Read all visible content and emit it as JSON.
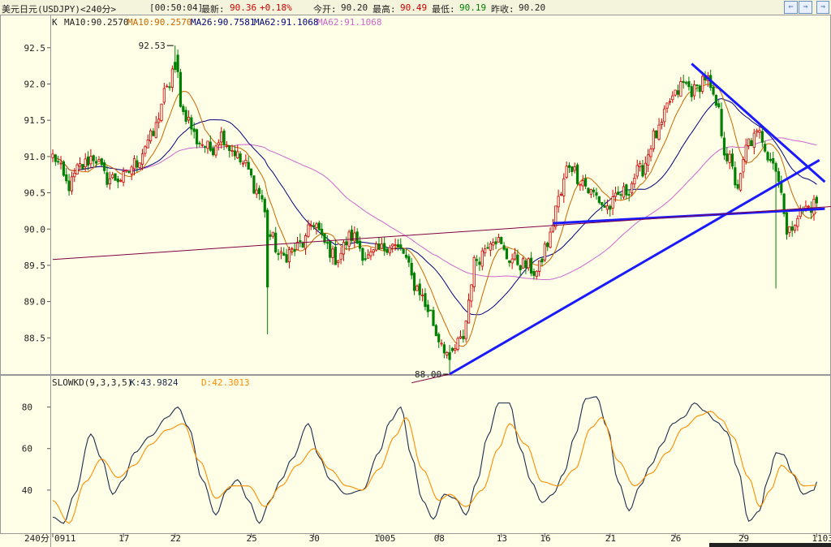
{
  "header": {
    "instrument": "美元日元(USDJPY)<240分>",
    "time": "[00:50:04]",
    "latest_label": "最新:",
    "latest_value": "90.36",
    "change": "+0.18%",
    "open_label": "今开:",
    "open_value": "90.20",
    "high_label": "最高:",
    "high_value": "90.49",
    "low_label": "最低:",
    "low_value": "90.19",
    "prev_label": "昨收:",
    "prev_value": "90.20",
    "buttons": [
      "⇐",
      "⇒",
      "⇐",
      "⇒"
    ]
  },
  "colors": {
    "background": "#ffffe8",
    "up": "#d00000",
    "down": "#008000",
    "ma10": "#cc6600",
    "ma26": "#000080",
    "ma62": "#cc66cc",
    "trendline": "#1a1aff",
    "horizontal": "#800040",
    "k_line": "#1c2c4c",
    "d_line": "#ff8c00"
  },
  "indicator_bar": {
    "k_label": "K",
    "ma10_a": "MA10:90.2570",
    "ma10_b": "MA10:90.2570",
    "ma26": "MA26:90.7581",
    "ma62_a": "MA62:91.1068",
    "ma62_b": "MA62:91.1068"
  },
  "kd_bar": {
    "name": "SLOWKD(9,3,3,5)",
    "k": "K:43.9824",
    "d": "D:42.3013"
  },
  "annotations": {
    "high_marker": "92.53",
    "low_marker": "88.00"
  },
  "bottom_axis": {
    "period": "240分",
    "labels": [
      "0911",
      "17",
      "22",
      "25",
      "30",
      "1005",
      "08",
      "13",
      "16",
      "21",
      "26",
      "29",
      "1103"
    ]
  },
  "chart_data": [
    {
      "type": "candlestick",
      "series_name": "USDJPY 240分",
      "ylim": [
        88.0,
        92.8
      ],
      "yticks": [
        "92.5",
        "92.0",
        "91.5",
        "91.0",
        "90.5",
        "90.0",
        "89.5",
        "89.0",
        "88.5"
      ],
      "ytick_values": [
        92.5,
        92.0,
        91.5,
        91.0,
        90.5,
        90.0,
        89.5,
        89.0,
        88.5
      ],
      "xtick_labels": [
        "0911",
        "17",
        "22",
        "25",
        "30",
        "1005",
        "08",
        "13",
        "16",
        "21",
        "26",
        "29",
        "1103"
      ],
      "xtick_bar_index": [
        0,
        26,
        45,
        73,
        96,
        120,
        142,
        165,
        181,
        205,
        229,
        254,
        281
      ],
      "bar_count": 282,
      "high": 92.53,
      "low": 88.0,
      "last_close": 90.36,
      "ma_latest": {
        "MA10": 90.257,
        "MA26": 90.7581,
        "MA62": 91.1068
      },
      "anchors": [
        [
          0,
          91.0
        ],
        [
          6,
          90.6
        ],
        [
          10,
          90.85
        ],
        [
          15,
          91.0
        ],
        [
          20,
          90.7
        ],
        [
          26,
          90.7
        ],
        [
          30,
          90.9
        ],
        [
          36,
          91.25
        ],
        [
          42,
          91.9
        ],
        [
          45,
          92.3
        ],
        [
          48,
          91.6
        ],
        [
          54,
          91.2
        ],
        [
          58,
          91.1
        ],
        [
          62,
          91.3
        ],
        [
          66,
          91.1
        ],
        [
          70,
          90.9
        ],
        [
          76,
          90.5
        ],
        [
          80,
          89.9
        ],
        [
          84,
          89.6
        ],
        [
          88,
          89.7
        ],
        [
          92,
          89.8
        ],
        [
          96,
          90.1
        ],
        [
          100,
          89.8
        ],
        [
          104,
          89.6
        ],
        [
          110,
          89.9
        ],
        [
          116,
          89.6
        ],
        [
          120,
          89.7
        ],
        [
          124,
          89.8
        ],
        [
          128,
          89.7
        ],
        [
          134,
          89.2
        ],
        [
          138,
          88.9
        ],
        [
          142,
          88.5
        ],
        [
          146,
          88.25
        ],
        [
          150,
          88.45
        ],
        [
          156,
          89.6
        ],
        [
          162,
          89.9
        ],
        [
          168,
          89.6
        ],
        [
          174,
          89.5
        ],
        [
          178,
          89.4
        ],
        [
          182,
          89.8
        ],
        [
          186,
          90.4
        ],
        [
          190,
          90.9
        ],
        [
          194,
          90.7
        ],
        [
          198,
          90.5
        ],
        [
          204,
          90.3
        ],
        [
          210,
          90.5
        ],
        [
          216,
          90.8
        ],
        [
          222,
          91.3
        ],
        [
          228,
          91.8
        ],
        [
          232,
          92.0
        ],
        [
          236,
          91.9
        ],
        [
          240,
          92.1
        ],
        [
          244,
          91.7
        ],
        [
          248,
          91.0
        ],
        [
          252,
          90.6
        ],
        [
          256,
          91.2
        ],
        [
          260,
          91.3
        ],
        [
          264,
          91.0
        ],
        [
          268,
          90.6
        ],
        [
          270,
          89.9
        ],
        [
          274,
          90.2
        ],
        [
          278,
          90.3
        ],
        [
          281,
          90.36
        ]
      ],
      "trendlines": [
        {
          "name": "rising-support",
          "from": [
            146,
            88.0
          ],
          "to": [
            282,
            90.95
          ]
        },
        {
          "name": "falling-resistance",
          "from": [
            235,
            92.28
          ],
          "to": [
            284,
            90.65
          ]
        },
        {
          "name": "flat-support",
          "from": [
            184,
            90.08
          ],
          "to": [
            284,
            90.28
          ]
        },
        {
          "name": "long-horizontal",
          "from": [
            0,
            89.58
          ],
          "to": [
            302,
            90.35
          ]
        },
        {
          "name": "extension",
          "from": [
            132,
            87.88
          ],
          "to": [
            146,
            88.0
          ]
        }
      ]
    },
    {
      "type": "line",
      "title": "SLOWKD(9,3,3,5)",
      "ylim": [
        20,
        90
      ],
      "yticks": [
        "80",
        "60",
        "40"
      ],
      "ytick_values": [
        80,
        60,
        40
      ],
      "series": [
        {
          "name": "K",
          "latest": 43.9824,
          "anchors": [
            [
              0,
              27
            ],
            [
              4,
              24
            ],
            [
              8,
              38
            ],
            [
              14,
              67
            ],
            [
              18,
              55
            ],
            [
              22,
              38
            ],
            [
              26,
              45
            ],
            [
              30,
              58
            ],
            [
              36,
              66
            ],
            [
              42,
              75
            ],
            [
              46,
              80
            ],
            [
              50,
              70
            ],
            [
              55,
              45
            ],
            [
              60,
              28
            ],
            [
              64,
              40
            ],
            [
              68,
              45
            ],
            [
              72,
              35
            ],
            [
              76,
              24
            ],
            [
              80,
              35
            ],
            [
              84,
              45
            ],
            [
              88,
              55
            ],
            [
              94,
              72
            ],
            [
              98,
              56
            ],
            [
              102,
              45
            ],
            [
              108,
              38
            ],
            [
              114,
              40
            ],
            [
              120,
              58
            ],
            [
              124,
              73
            ],
            [
              128,
              80
            ],
            [
              132,
              56
            ],
            [
              136,
              35
            ],
            [
              140,
              26
            ],
            [
              144,
              38
            ],
            [
              148,
              36
            ],
            [
              152,
              28
            ],
            [
              156,
              44
            ],
            [
              160,
              66
            ],
            [
              164,
              82
            ],
            [
              168,
              82
            ],
            [
              172,
              60
            ],
            [
              176,
              44
            ],
            [
              180,
              34
            ],
            [
              184,
              38
            ],
            [
              188,
              48
            ],
            [
              192,
              66
            ],
            [
              196,
              84
            ],
            [
              200,
              85
            ],
            [
              204,
              70
            ],
            [
              208,
              44
            ],
            [
              212,
              30
            ],
            [
              216,
              42
            ],
            [
              220,
              52
            ],
            [
              224,
              62
            ],
            [
              228,
              72
            ],
            [
              232,
              75
            ],
            [
              236,
              82
            ],
            [
              240,
              78
            ],
            [
              244,
              73
            ],
            [
              248,
              68
            ],
            [
              252,
              50
            ],
            [
              256,
              25
            ],
            [
              260,
              30
            ],
            [
              263,
              45
            ],
            [
              266,
              58
            ],
            [
              269,
              57
            ],
            [
              272,
              48
            ],
            [
              276,
              38
            ],
            [
              280,
              40
            ],
            [
              281,
              43.98
            ]
          ]
        },
        {
          "name": "D",
          "latest": 42.3013,
          "anchors": [
            [
              0,
              35
            ],
            [
              6,
              24
            ],
            [
              12,
              44
            ],
            [
              18,
              55
            ],
            [
              24,
              46
            ],
            [
              30,
              52
            ],
            [
              36,
              62
            ],
            [
              42,
              69
            ],
            [
              48,
              72
            ],
            [
              54,
              54
            ],
            [
              60,
              36
            ],
            [
              66,
              42
            ],
            [
              72,
              42
            ],
            [
              78,
              32
            ],
            [
              84,
              42
            ],
            [
              90,
              52
            ],
            [
              96,
              60
            ],
            [
              102,
              50
            ],
            [
              108,
              42
            ],
            [
              114,
              40
            ],
            [
              120,
              50
            ],
            [
              126,
              66
            ],
            [
              130,
              75
            ],
            [
              136,
              50
            ],
            [
              142,
              35
            ],
            [
              146,
              38
            ],
            [
              152,
              32
            ],
            [
              158,
              40
            ],
            [
              164,
              60
            ],
            [
              168,
              72
            ],
            [
              174,
              62
            ],
            [
              180,
              44
            ],
            [
              186,
              42
            ],
            [
              192,
              50
            ],
            [
              198,
              70
            ],
            [
              202,
              75
            ],
            [
              208,
              54
            ],
            [
              214,
              42
            ],
            [
              220,
              48
            ],
            [
              226,
              58
            ],
            [
              232,
              70
            ],
            [
              238,
              76
            ],
            [
              242,
              78
            ],
            [
              246,
              74
            ],
            [
              250,
              66
            ],
            [
              256,
              46
            ],
            [
              260,
              32
            ],
            [
              264,
              40
            ],
            [
              268,
              52
            ],
            [
              272,
              48
            ],
            [
              276,
              42
            ],
            [
              281,
              42.3
            ]
          ]
        }
      ]
    }
  ]
}
